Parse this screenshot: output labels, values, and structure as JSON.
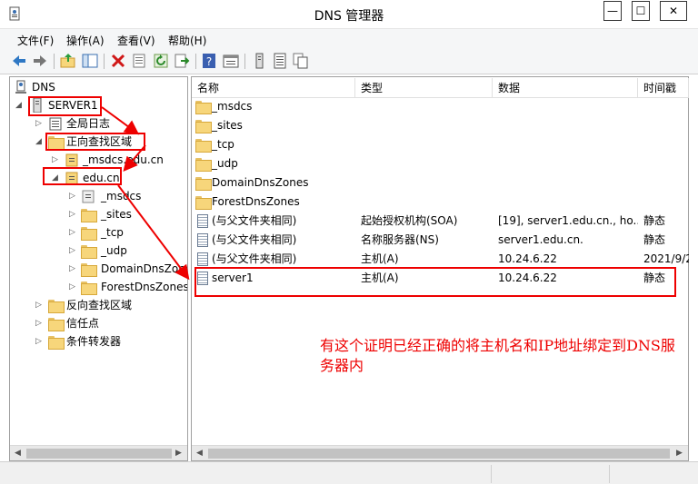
{
  "window": {
    "title": "DNS 管理器",
    "minimize": "—",
    "maximize": "☐",
    "close": "✕"
  },
  "menu": [
    "文件(F)",
    "操作(A)",
    "查看(V)",
    "帮助(H)"
  ],
  "toolbar_icons": [
    "back-icon",
    "forward-icon",
    "up-folder-icon",
    "show-hide-tree-icon",
    "delete-icon",
    "properties-icon",
    "refresh-icon",
    "export-list-icon",
    "help-icon",
    "view-icon",
    "server-icon",
    "list-icon",
    "copy-icon"
  ],
  "tree": {
    "root": "DNS",
    "server": "SERVER1",
    "global_logs": "全局日志",
    "forward_zones": "正向查找区域",
    "msdcs_zone": "_msdcs.edu.cn",
    "edu_zone": "edu.cn",
    "edu_children": [
      "_msdcs",
      "_sites",
      "_tcp",
      "_udp",
      "DomainDnsZones",
      "ForestDnsZones"
    ],
    "reverse_zones": "反向查找区域",
    "trust_points": "信任点",
    "conditional_forwarders": "条件转发器"
  },
  "list": {
    "columns": [
      "名称",
      "类型",
      "数据",
      "时间戳"
    ],
    "rows": [
      {
        "name": "_msdcs",
        "type": "",
        "data": "",
        "timestamp": "",
        "kind": "folder"
      },
      {
        "name": "_sites",
        "type": "",
        "data": "",
        "timestamp": "",
        "kind": "folder"
      },
      {
        "name": "_tcp",
        "type": "",
        "data": "",
        "timestamp": "",
        "kind": "folder"
      },
      {
        "name": "_udp",
        "type": "",
        "data": "",
        "timestamp": "",
        "kind": "folder"
      },
      {
        "name": "DomainDnsZones",
        "type": "",
        "data": "",
        "timestamp": "",
        "kind": "folder"
      },
      {
        "name": "ForestDnsZones",
        "type": "",
        "data": "",
        "timestamp": "",
        "kind": "folder"
      },
      {
        "name": "(与父文件夹相同)",
        "type": "起始授权机构(SOA)",
        "data": "[19], server1.edu.cn., ho...",
        "timestamp": "静态",
        "kind": "record"
      },
      {
        "name": "(与父文件夹相同)",
        "type": "名称服务器(NS)",
        "data": "server1.edu.cn.",
        "timestamp": "静态",
        "kind": "record"
      },
      {
        "name": "(与父文件夹相同)",
        "type": "主机(A)",
        "data": "10.24.6.22",
        "timestamp": "2021/9/2",
        "kind": "record"
      },
      {
        "name": "server1",
        "type": "主机(A)",
        "data": "10.24.6.22",
        "timestamp": "静态",
        "kind": "record"
      }
    ]
  },
  "annotation": "有这个证明已经正确的将主机名和IP地址绑定到DNS服务器内",
  "colors": {
    "highlight": "#e00000",
    "folder": "#f7d67b",
    "pane_border": "#a0a0a0"
  }
}
